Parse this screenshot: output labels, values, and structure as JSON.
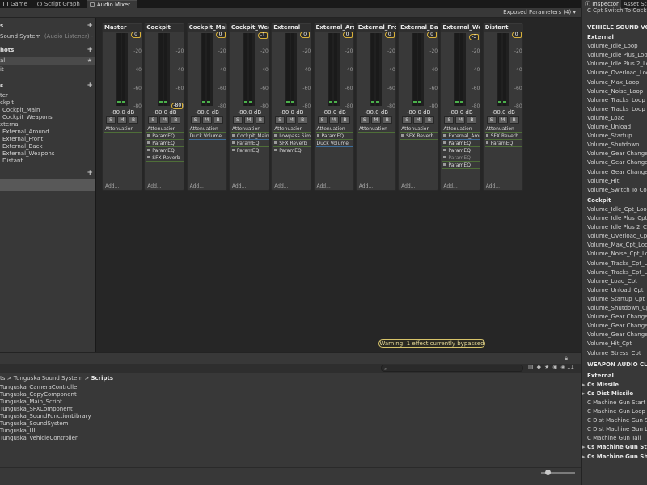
{
  "tabs": [
    {
      "label": "Game",
      "active": false
    },
    {
      "label": "Script Graph",
      "active": false
    },
    {
      "label": "Audio Mixer",
      "active": true
    }
  ],
  "toolbar": {
    "exposed_params": "Exposed Parameters (4)"
  },
  "left_panel": {
    "mixers_title": "s",
    "mixer_name": "Sound System",
    "mixer_listener": "(Audio Listener) - ",
    "snapshots_title": "hots",
    "snapshots": [
      "al",
      "it"
    ],
    "groups_title": "s",
    "groups": [
      "ter",
      "ckpit",
      "Cockpit_Main",
      "Cockpit_Weapons",
      "xternal",
      "External_Around",
      "External_Front",
      "External_Back",
      "External_Weapons",
      "Distant"
    ]
  },
  "mixer": {
    "ticks": [
      "0",
      "-20",
      "-40",
      "-60",
      "-80"
    ],
    "solo": "S",
    "mute": "M",
    "bypass": "B",
    "add_label": "Add...",
    "strips": [
      {
        "name": "Master",
        "db": "-80.0 dB",
        "fader": "0",
        "effects": [
          {
            "label": "Attenuation",
            "dot": false,
            "color": "green"
          }
        ]
      },
      {
        "name": "Cockpit",
        "db": "-80.0 dB",
        "fader": "-80",
        "effects": [
          {
            "label": "Attenuation",
            "dot": false,
            "color": "green"
          },
          {
            "label": "ParamEQ",
            "dot": true,
            "color": "green"
          },
          {
            "label": "ParamEQ",
            "dot": true,
            "color": "green"
          },
          {
            "label": "ParamEQ",
            "dot": true,
            "color": "green"
          },
          {
            "label": "SFX Reverb",
            "dot": true,
            "color": "green"
          }
        ]
      },
      {
        "name": "Cockpit_Main",
        "db": "-80.0 dB",
        "fader": "0",
        "effects": [
          {
            "label": "Attenuation",
            "dot": false,
            "color": "green"
          },
          {
            "label": "Duck Volume",
            "dot": false,
            "color": "blue"
          }
        ]
      },
      {
        "name": "Cockpit_Weap",
        "db": "-80.0 dB",
        "fader": "-1",
        "effects": [
          {
            "label": "Attenuation",
            "dot": false,
            "color": "green"
          },
          {
            "label": "Cockpit_Main",
            "dot": true,
            "color": "blue"
          },
          {
            "label": "ParamEQ",
            "dot": true,
            "color": "green"
          },
          {
            "label": "ParamEQ",
            "dot": true,
            "color": "green"
          }
        ]
      },
      {
        "name": "External",
        "db": "-80.0 dB",
        "fader": "0",
        "effects": [
          {
            "label": "Attenuation",
            "dot": false,
            "color": "green"
          },
          {
            "label": "Lowpass Sim",
            "dot": true,
            "color": "green"
          },
          {
            "label": "SFX Reverb",
            "dot": true,
            "color": "green"
          },
          {
            "label": "ParamEQ",
            "dot": true,
            "color": "green"
          }
        ]
      },
      {
        "name": "External_Arou",
        "db": "-80.0 dB",
        "fader": "0",
        "effects": [
          {
            "label": "Attenuation",
            "dot": false,
            "color": "green"
          },
          {
            "label": "ParamEQ",
            "dot": true,
            "color": "green"
          },
          {
            "label": "Duck Volume",
            "dot": false,
            "color": "blue"
          }
        ]
      },
      {
        "name": "External_Front",
        "db": "-80.0 dB",
        "fader": "0",
        "effects": [
          {
            "label": "Attenuation",
            "dot": false,
            "color": "green"
          }
        ]
      },
      {
        "name": "External_Back",
        "db": "-80.0 dB",
        "fader": "0",
        "effects": [
          {
            "label": "Attenuation",
            "dot": false,
            "color": "green"
          },
          {
            "label": "SFX Reverb",
            "dot": true,
            "color": "green"
          }
        ]
      },
      {
        "name": "External_Wea",
        "db": "-80.0 dB",
        "fader": "-3",
        "effects": [
          {
            "label": "Attenuation",
            "dot": false,
            "color": "green"
          },
          {
            "label": "External_Arou",
            "dot": true,
            "color": "blue"
          },
          {
            "label": "ParamEQ",
            "dot": true,
            "color": "green"
          },
          {
            "label": "ParamEQ",
            "dot": true,
            "color": "green"
          },
          {
            "label": "ParamEQ",
            "dot": true,
            "color": "green",
            "dim": true
          },
          {
            "label": "ParamEQ",
            "dot": true,
            "color": "green"
          }
        ]
      },
      {
        "name": "Distant",
        "db": "-80.0 dB",
        "fader": "0",
        "effects": [
          {
            "label": "Attenuation",
            "dot": false,
            "color": "green"
          },
          {
            "label": "SFX Reverb",
            "dot": true,
            "color": "green"
          },
          {
            "label": "ParamEQ",
            "dot": true,
            "color": "green"
          }
        ]
      }
    ],
    "warning": "Warning: 1 effect currently bypassed"
  },
  "project": {
    "breadcrumb_prefix": "ts",
    "breadcrumb_mid": "Tunguska Sound System",
    "breadcrumb_last": "Scripts",
    "count": "11",
    "files": [
      "Tunguska_CameraController",
      "Tunguska_CopyComponent",
      "Tunguska_Main_Script",
      "Tunguska_SFXComponent",
      "Tunguska_SoundFunctionLibrary",
      "Tunguska_SoundSystem",
      "Tunguska_UI",
      "Tunguska_VehicleController"
    ]
  },
  "inspector": {
    "tabs": [
      "Inspector",
      "Asset Sto"
    ],
    "subtitle": "C Cpt Switch To Cockp",
    "rows": [
      {
        "text": "VEHICLE SOUND VOLU",
        "style": "head"
      },
      {
        "text": "External",
        "style": "bold"
      },
      {
        "text": "Volume_Idle_Loop"
      },
      {
        "text": "Volume_Idle Plus_Loop"
      },
      {
        "text": "Volume_Idle Plus 2_Loo"
      },
      {
        "text": "Volume_Overload_Loop"
      },
      {
        "text": "Volume_Max_Loop"
      },
      {
        "text": "Volume_Noise_Loop"
      },
      {
        "text": "Volume_Tracks_Loop_1"
      },
      {
        "text": "Volume_Tracks_Loop_2"
      },
      {
        "text": "Volume_Load"
      },
      {
        "text": "Volume_Unload"
      },
      {
        "text": "Volume_Startup"
      },
      {
        "text": "Volume_Shutdown"
      },
      {
        "text": "Volume_Gear Change"
      },
      {
        "text": "Volume_Gear Change_S"
      },
      {
        "text": "Volume_Gear Change_E"
      },
      {
        "text": "Volume_Hit"
      },
      {
        "text": "Volume_Switch To Cock"
      },
      {
        "text": "Cockpit",
        "style": "bold"
      },
      {
        "text": "Volume_Idle_Cpt_Loop"
      },
      {
        "text": "Volume_Idle Plus_Cpt_L"
      },
      {
        "text": "Volume_Idle Plus 2_Cpt"
      },
      {
        "text": "Volume_Overload_Cpt_L"
      },
      {
        "text": "Volume_Max_Cpt_Loop"
      },
      {
        "text": "Volume_Noise_Cpt_Loop"
      },
      {
        "text": "Volume_Tracks_Cpt_Loo"
      },
      {
        "text": "Volume_Tracks_Cpt_Loo"
      },
      {
        "text": "Volume_Load_Cpt"
      },
      {
        "text": "Volume_Unload_Cpt"
      },
      {
        "text": "Volume_Startup_Cpt"
      },
      {
        "text": "Volume_Shutdown_Cpt"
      },
      {
        "text": "Volume_Gear Change_C"
      },
      {
        "text": "Volume_Gear Change_S"
      },
      {
        "text": "Volume_Gear Change_E"
      },
      {
        "text": "Volume_Hit_Cpt"
      },
      {
        "text": "Volume_Stress_Cpt"
      },
      {
        "text": "WEAPON AUDIO CLIPS",
        "style": "head"
      },
      {
        "text": "External",
        "style": "bold"
      },
      {
        "text": "Cs Missile",
        "style": "bold",
        "arrow": true
      },
      {
        "text": "Cs Dist Missile",
        "style": "bold",
        "arrow": true
      },
      {
        "text": "C Machine Gun Start"
      },
      {
        "text": "C Machine Gun Loop"
      },
      {
        "text": "C Dist Machine Gun Sta"
      },
      {
        "text": "C Dist Machine Gun Loo"
      },
      {
        "text": "C Machine Gun Tail"
      },
      {
        "text": "Cs Machine Gun Stop",
        "style": "bold",
        "arrow": true
      },
      {
        "text": "Cs Machine Gun Short",
        "style": "bold",
        "arrow": true
      }
    ]
  }
}
